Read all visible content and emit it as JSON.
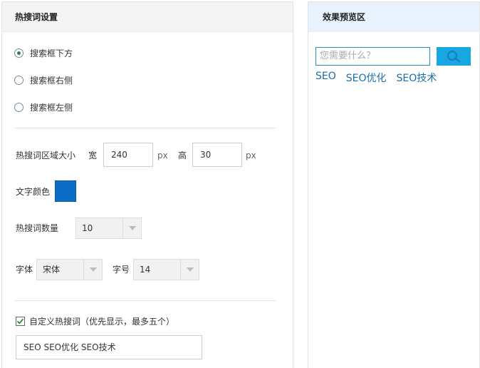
{
  "settings": {
    "title": "热搜词设置",
    "position_options": [
      {
        "label": "搜索框下方",
        "selected": true
      },
      {
        "label": "搜索框右侧",
        "selected": false
      },
      {
        "label": "搜索框左侧",
        "selected": false
      }
    ],
    "area_size": {
      "label": "热搜词区域大小",
      "width_label": "宽",
      "width_value": "240",
      "width_unit": "px",
      "height_label": "高",
      "height_value": "30",
      "height_unit": "px"
    },
    "text_color": {
      "label": "文字颜色",
      "value": "#0a6cc4"
    },
    "count": {
      "label": "热搜词数量",
      "value": "10"
    },
    "font": {
      "label": "字体",
      "value": "宋体"
    },
    "font_size": {
      "label": "字号",
      "value": "14"
    },
    "custom": {
      "checked": true,
      "label": "自定义热搜词（优先显示，最多五个）",
      "value": "SEO SEO优化 SEO技术"
    }
  },
  "preview": {
    "title": "效果预览区",
    "search_placeholder": "您需要什么？",
    "hot_words": [
      "SEO",
      "SEO优化",
      "SEO技术"
    ]
  },
  "colors": {
    "accent": "#18a7e2",
    "hot_word": "#1a6ea8",
    "preview_header_bg": "#e7f2fc"
  }
}
